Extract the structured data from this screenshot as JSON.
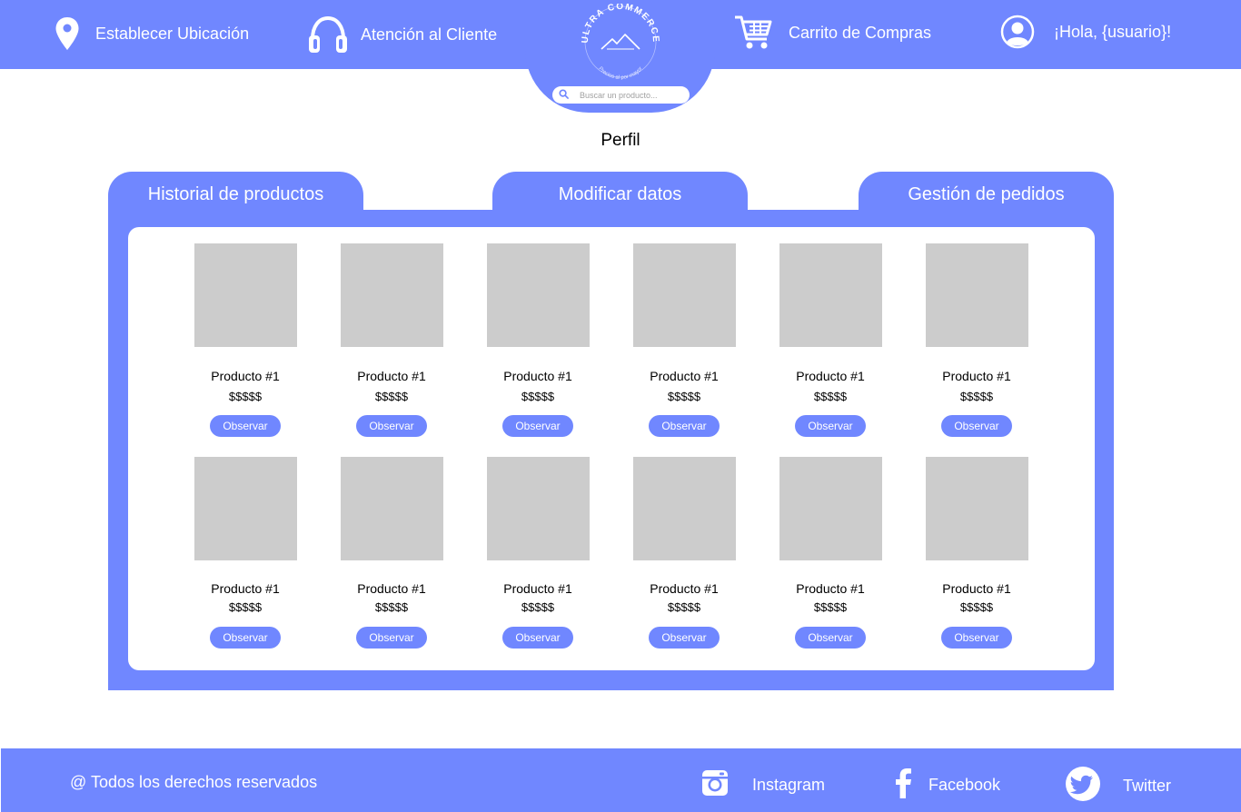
{
  "header": {
    "location_label": "Establecer Ubicación",
    "support_label": "Atención al Cliente",
    "cart_label": "Carrito de Compras",
    "greeting": "¡Hola, {usuario}!",
    "logo_top_text": "ULTRA COMMERCE",
    "logo_bottom_text": "Precios al por mayor",
    "search_placeholder": "Buscar un producto..."
  },
  "page": {
    "title": "Perfil"
  },
  "tabs": [
    {
      "label": "Historial de productos"
    },
    {
      "label": "Modificar datos"
    },
    {
      "label": "Gestión de pedidos"
    }
  ],
  "products": [
    {
      "name": "Producto #1",
      "price": "$$$$$",
      "button": "Observar"
    },
    {
      "name": "Producto #1",
      "price": "$$$$$",
      "button": "Observar"
    },
    {
      "name": "Producto #1",
      "price": "$$$$$",
      "button": "Observar"
    },
    {
      "name": "Producto #1",
      "price": "$$$$$",
      "button": "Observar"
    },
    {
      "name": "Producto #1",
      "price": "$$$$$",
      "button": "Observar"
    },
    {
      "name": "Producto #1",
      "price": "$$$$$",
      "button": "Observar"
    },
    {
      "name": "Producto #1",
      "price": "$$$$$",
      "button": "Observar"
    },
    {
      "name": "Producto #1",
      "price": "$$$$$",
      "button": "Observar"
    },
    {
      "name": "Producto #1",
      "price": "$$$$$",
      "button": "Observar"
    },
    {
      "name": "Producto #1",
      "price": "$$$$$",
      "button": "Observar"
    },
    {
      "name": "Producto #1",
      "price": "$$$$$",
      "button": "Observar"
    },
    {
      "name": "Producto #1",
      "price": "$$$$$",
      "button": "Observar"
    }
  ],
  "footer": {
    "copyright": "@ Todos los derechos reservados",
    "social": [
      {
        "label": "Instagram",
        "icon": "instagram-icon"
      },
      {
        "label": "Facebook",
        "icon": "facebook-icon"
      },
      {
        "label": "Twitter",
        "icon": "twitter-icon"
      }
    ]
  },
  "colors": {
    "primary": "#7087ff",
    "placeholder": "#cccccc",
    "background": "#ffffff"
  }
}
